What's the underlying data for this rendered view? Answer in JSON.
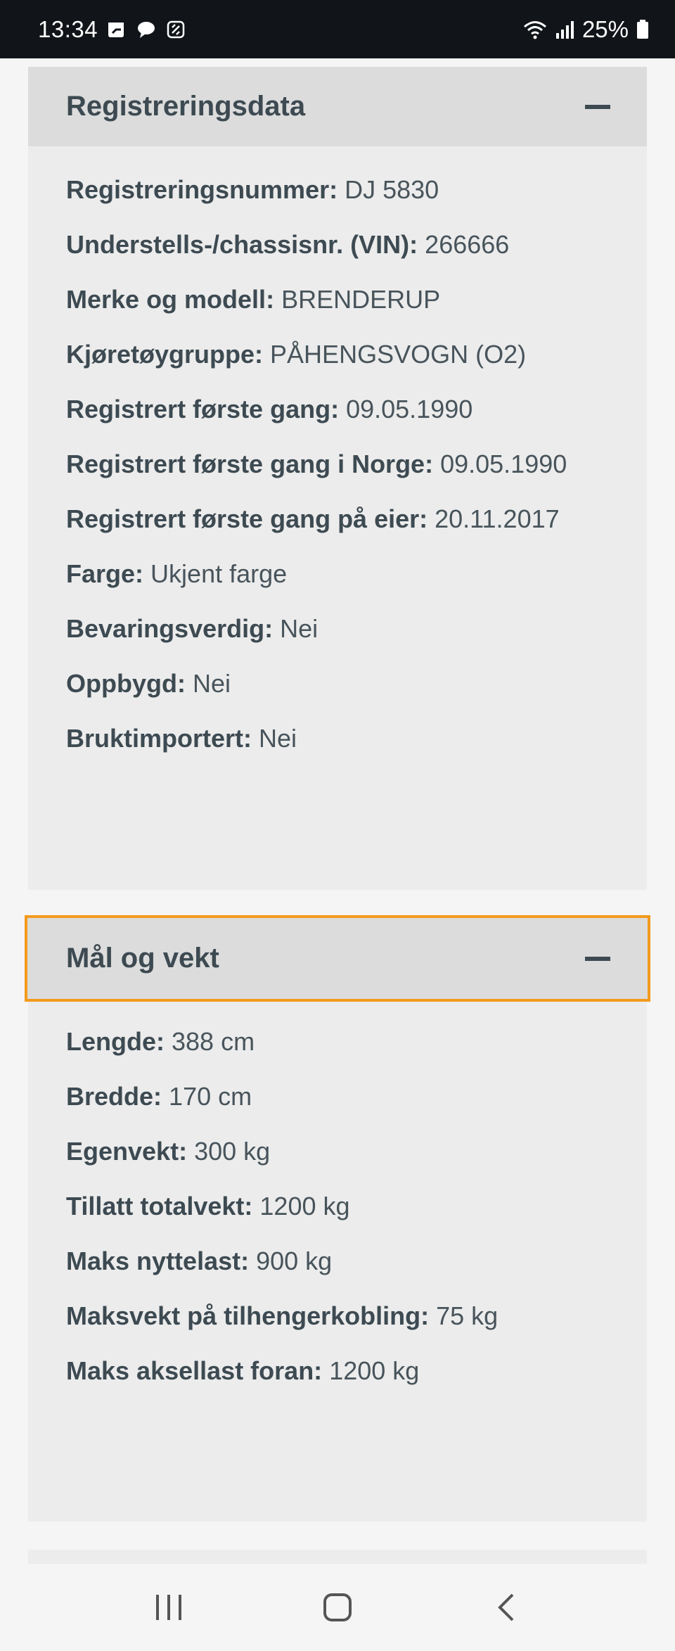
{
  "status_bar": {
    "time": "13:34",
    "battery": "25%",
    "icons": [
      "calendar-notification-icon",
      "chat-icon",
      "copilot-icon",
      "wifi-icon",
      "signal-icon",
      "battery-icon"
    ]
  },
  "sections": [
    {
      "title": "Registreringsdata",
      "fields": [
        {
          "label": "Registreringsnummer:",
          "value": "DJ 5830"
        },
        {
          "label": "Understells-/chassisnr. (VIN):",
          "value": "266666"
        },
        {
          "label": "Merke og modell:",
          "value": "BRENDERUP"
        },
        {
          "label": "Kjøretøygruppe:",
          "value": "PÅHENGSVOGN (O2)"
        },
        {
          "label": "Registrert første gang:",
          "value": "09.05.1990"
        },
        {
          "label": "Registrert første gang i Norge:",
          "value": "09.05.1990"
        },
        {
          "label": "Registrert første gang på eier:",
          "value": "20.11.2017"
        },
        {
          "label": "Farge:",
          "value": "Ukjent farge"
        },
        {
          "label": "Bevaringsverdig:",
          "value": "Nei"
        },
        {
          "label": "Oppbygd:",
          "value": "Nei"
        },
        {
          "label": "Bruktimportert:",
          "value": "Nei"
        }
      ]
    },
    {
      "title": "Mål og vekt",
      "fields": [
        {
          "label": "Lengde:",
          "value": "388 cm"
        },
        {
          "label": "Bredde:",
          "value": "170 cm"
        },
        {
          "label": "Egenvekt:",
          "value": "300 kg"
        },
        {
          "label": "Tillatt totalvekt:",
          "value": "1200 kg"
        },
        {
          "label": "Maks nyttelast:",
          "value": "900 kg"
        },
        {
          "label": "Maksvekt på tilhengerkobling:",
          "value": "75 kg"
        },
        {
          "label": "Maks aksellast foran:",
          "value": "1200 kg"
        }
      ]
    }
  ],
  "colors": {
    "focus_outline": "#f39a1d",
    "header_bg": "#dcdcdc",
    "section_bg": "#ececec",
    "text": "#3d4a52"
  }
}
